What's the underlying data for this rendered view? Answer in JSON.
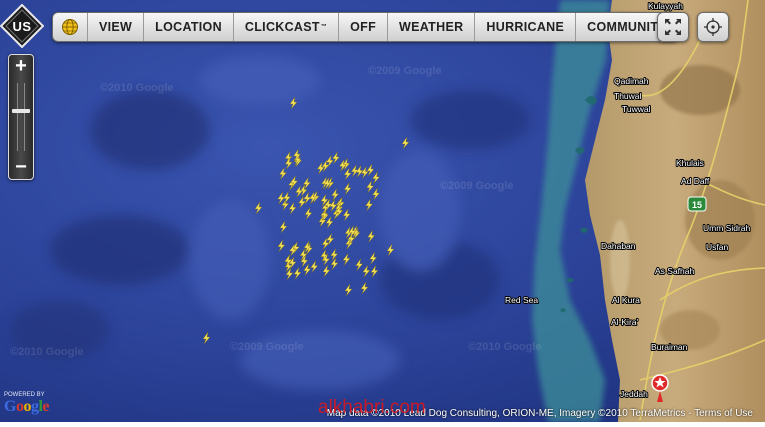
{
  "toolbar": {
    "region_badge": "US",
    "items": [
      "VIEW",
      "LOCATION",
      "CLICKCAST",
      "OFF",
      "WEATHER",
      "HURRICANE",
      "COMMUNITY"
    ],
    "clickcast_mark": "™",
    "globe_icon": "globe-icon",
    "fullscreen_icon": "expand-icon",
    "locate_icon": "crosshair-icon"
  },
  "zoom": {
    "in_label": "+",
    "out_label": "−",
    "level": 0.62
  },
  "map": {
    "sea_label": "Red Sea",
    "places": [
      "Kulayyah",
      "Qadimah",
      "Thuwal",
      "Tuwwal",
      "Khulais",
      "Ad Daff",
      "Umm Sidrah",
      "Dahaban",
      "Usfan",
      "As Safhah",
      "Al Kura",
      "Al-Kira'",
      "Buraiman",
      "Jeddah"
    ],
    "road_shield": "15",
    "tile_watermarks": [
      "©2009 Google",
      "©2010 Google",
      "©2009 Google",
      "©2010 Google",
      "©2009 Google",
      "©2010 Google"
    ],
    "lightning_color": "#f2df55",
    "marker_color": "#e02a2a"
  },
  "attribution": "Map data ©2010 Lead Dog Consulting, ORION-ME, Imagery ©2010 TerraMetrics - Terms of Use",
  "powered_by": "POWERED BY",
  "google_logo": "Google",
  "overlay_watermark": "alkhabri.com"
}
